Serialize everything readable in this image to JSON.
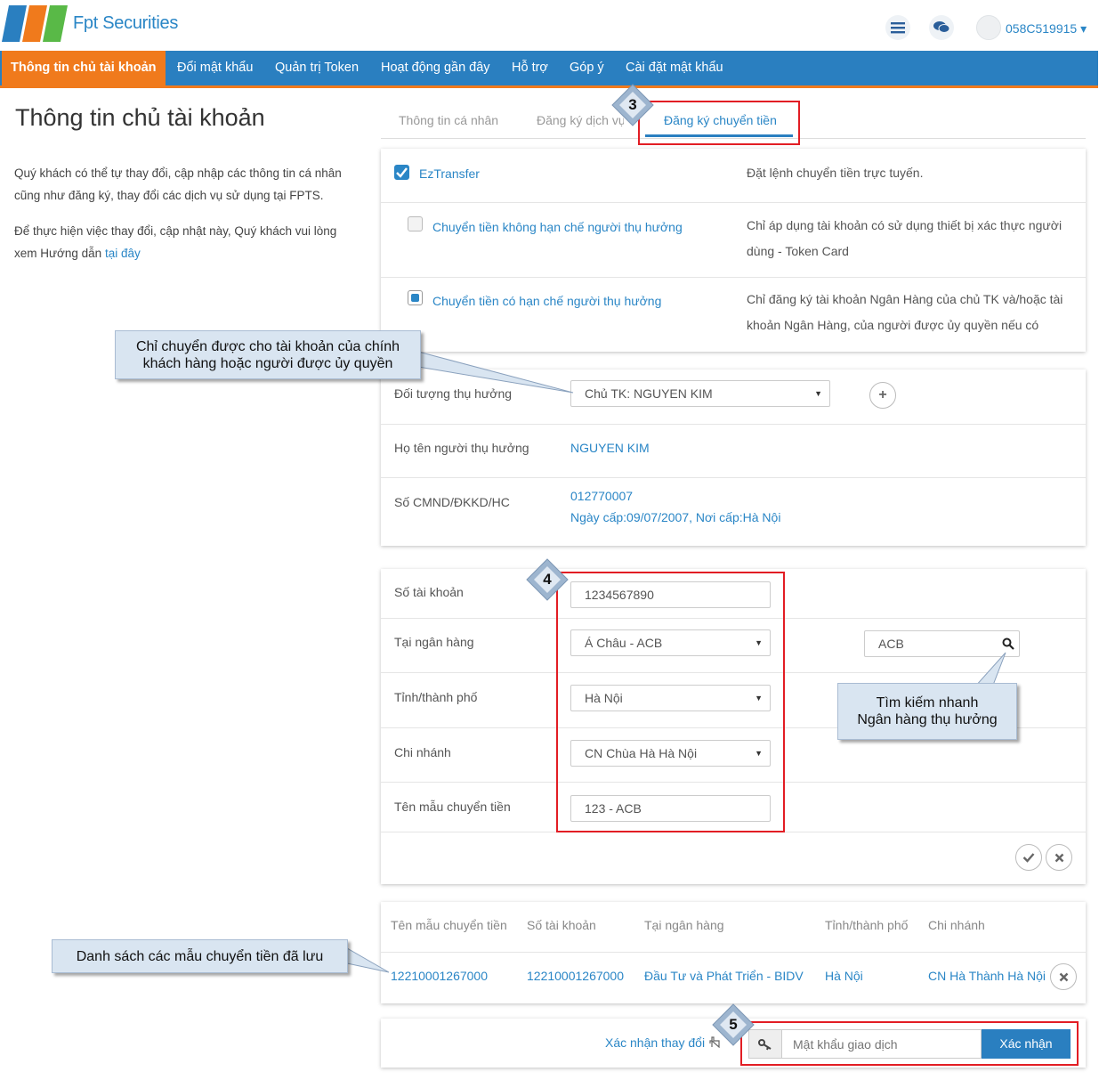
{
  "header": {
    "brand": "Fpt Securities",
    "user_id": "058C519915 ▾",
    "icons": [
      "menu-icon",
      "chat-icon",
      "user-avatar-icon"
    ]
  },
  "nav": {
    "items": [
      "Thông tin chủ tài khoản",
      "Đổi mật khẩu",
      "Quản trị Token",
      "Hoạt động gần đây",
      "Hỗ trợ",
      "Góp ý",
      "Cài đặt mật khẩu"
    ],
    "active_index": 0
  },
  "left": {
    "title": "Thông tin chủ tài khoản",
    "para1_line1": "Quý khách có thể tự thay đổi, cập nhập các thông tin cá nhân",
    "para1_line2": "cũng như đăng ký, thay đổi các dịch vụ sử dụng tại FPTS.",
    "para2_line1": "Để thực hiện việc thay đổi, cập nhật này, Quý khách vui lòng",
    "para2_line2": "xem Hướng dẫn",
    "para2_link": "tại đây"
  },
  "tabs": [
    "Thông tin cá nhân",
    "Đăng ký dịch vụ",
    "Đăng ký chuyển tiền"
  ],
  "services": {
    "eztransfer_label": "EzTransfer",
    "eztransfer_desc": "Đặt lệnh chuyển tiền trực tuyến.",
    "unlimited_label": "Chuyển tiền không hạn chế người thụ hưởng",
    "unlimited_desc1": "Chỉ áp dụng tài khoản có sử dụng thiết bị xác thực người",
    "unlimited_desc2": "dùng - Token Card",
    "limited_label": "Chuyển tiền có hạn chế người thụ hưởng",
    "limited_desc1": "Chỉ đăng ký tài khoản Ngân Hàng của chủ TK và/hoặc tài",
    "limited_desc2": "khoản Ngân Hàng, của người được ủy quyền nếu có"
  },
  "beneficiary": {
    "target_label": "Đối tượng thụ hưởng",
    "target_value": "Chủ TK: NGUYEN KIM",
    "name_label": "Họ tên người thụ hưởng",
    "name_value": "NGUYEN KIM",
    "id_label": "Số CMND/ĐKKD/HC",
    "id_value": "012770007",
    "id_issue": "Ngày cấp:09/07/2007, Nơi cấp:Hà Nội"
  },
  "account_form": {
    "account_label": "Số tài khoản",
    "account_value": "1234567890",
    "bank_label": "Tại ngân hàng",
    "bank_value": "Á Châu - ACB",
    "bank_search_value": "ACB",
    "city_label": "Tỉnh/thành phố",
    "city_value": "Hà Nội",
    "branch_label": "Chi nhánh",
    "branch_value": "CN Chùa Hà Hà Nội",
    "template_label": "Tên mẫu chuyển tiền",
    "template_value": "123 - ACB"
  },
  "saved_table": {
    "headers": [
      "Tên mẫu chuyển tiền",
      "Số tài khoản",
      "Tại ngân hàng",
      "Tỉnh/thành phố",
      "Chi nhánh"
    ],
    "row": [
      "12210001267000",
      "12210001267000",
      "Đầu Tư và Phát Triển - BIDV",
      "Hà Nội",
      "CN Hà Thành Hà Nội"
    ]
  },
  "footer": {
    "confirm_change": "Xác nhận thay đổi",
    "password_placeholder": "Mật khẩu giao dịch",
    "confirm_button": "Xác nhận"
  },
  "annotations": {
    "badge3": "3",
    "badge4": "4",
    "badge5": "5",
    "callout_owner_l1": "Chỉ chuyển được cho tài khoản của chính",
    "callout_owner_l2": "khách hàng hoặc người được ủy quyền",
    "callout_search_l1": "Tìm kiếm nhanh",
    "callout_search_l2": "Ngân hàng thụ hưởng",
    "callout_list": "Danh sách các mẫu chuyển tiền đã lưu"
  },
  "colors": {
    "brand_blue": "#2a7fc0",
    "accent_orange": "#f07a1c",
    "annotation_red": "#e21d24"
  }
}
